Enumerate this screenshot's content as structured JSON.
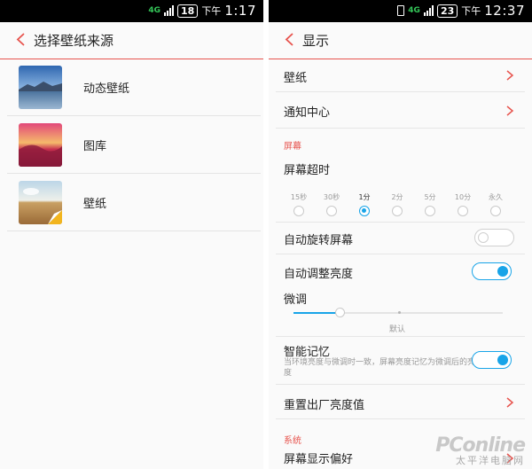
{
  "left_screen": {
    "statusbar": {
      "badge": "18",
      "prefix": "下午",
      "time": "1:17",
      "net": "4G"
    },
    "header": {
      "title": "选择壁纸来源"
    },
    "items": [
      {
        "label": "动态壁纸",
        "thumb": "live-wallpaper-thumb"
      },
      {
        "label": "图库",
        "thumb": "gallery-thumb"
      },
      {
        "label": "壁纸",
        "thumb": "wallpaper-thumb"
      }
    ]
  },
  "right_screen": {
    "statusbar": {
      "badge": "23",
      "prefix": "下午",
      "time": "12:37",
      "net": "4G"
    },
    "header": {
      "title": "显示"
    },
    "rows": {
      "wallpaper": "壁纸",
      "notification_center": "通知中心",
      "screen_timeout": "屏幕超时",
      "auto_rotate": "自动旋转屏幕",
      "auto_brightness": "自动调整亮度",
      "fine_tune": "微调",
      "smart_memory": "智能记忆",
      "reset_brightness": "重置出厂亮度值",
      "display_preference": "屏幕显示偏好"
    },
    "sections": {
      "screen": "屏幕",
      "system": "系统"
    },
    "timeout_options": [
      "15秒",
      "30秒",
      "1分",
      "2分",
      "5分",
      "10分",
      "永久"
    ],
    "timeout_selected_index": 2,
    "toggles": {
      "auto_rotate": false,
      "auto_brightness": true,
      "smart_memory": true
    },
    "brightness": {
      "value": 0.22,
      "default_position": 0.5,
      "default_label": "默认"
    },
    "smart_memory_desc": "当环境亮度与微调时一致，屏幕亮度记忆为微调后的亮度"
  },
  "watermark": {
    "logo": "PConline",
    "sub": "太平洋电脑网"
  },
  "colors": {
    "accent": "#e7534d",
    "switch_on": "#18a4e8",
    "divider": "#e6e6e6"
  }
}
